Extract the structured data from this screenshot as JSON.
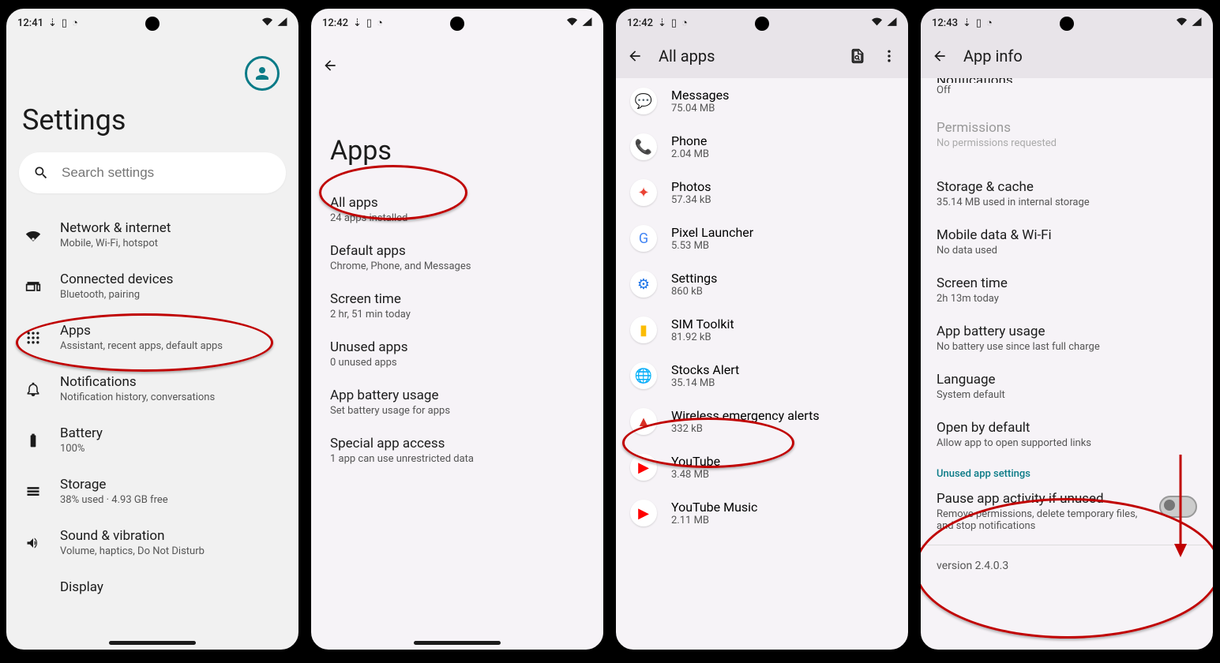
{
  "phones": [
    {
      "time": "12:41",
      "title": "Settings",
      "search_placeholder": "Search settings",
      "items": [
        {
          "title": "Network & internet",
          "sub": "Mobile, Wi-Fi, hotspot"
        },
        {
          "title": "Connected devices",
          "sub": "Bluetooth, pairing"
        },
        {
          "title": "Apps",
          "sub": "Assistant, recent apps, default apps"
        },
        {
          "title": "Notifications",
          "sub": "Notification history, conversations"
        },
        {
          "title": "Battery",
          "sub": "100%"
        },
        {
          "title": "Storage",
          "sub": "38% used · 4.93 GB free"
        },
        {
          "title": "Sound & vibration",
          "sub": "Volume, haptics, Do Not Disturb"
        },
        {
          "title": "Display",
          "sub": ""
        }
      ]
    },
    {
      "time": "12:42",
      "title": "Apps",
      "items": [
        {
          "title": "All apps",
          "sub": "24 apps installed"
        },
        {
          "title": "Default apps",
          "sub": "Chrome, Phone, and Messages"
        },
        {
          "title": "Screen time",
          "sub": "2 hr, 51 min today"
        },
        {
          "title": "Unused apps",
          "sub": "0 unused apps"
        },
        {
          "title": "App battery usage",
          "sub": "Set battery usage for apps"
        },
        {
          "title": "Special app access",
          "sub": "1 app can use unrestricted data"
        }
      ]
    },
    {
      "time": "12:42",
      "title": "All apps",
      "apps": [
        {
          "name": "Messages",
          "size": "75.04 MB",
          "color": "#1a73e8",
          "glyph": "💬"
        },
        {
          "name": "Phone",
          "size": "2.04 MB",
          "color": "#1a73e8",
          "glyph": "📞"
        },
        {
          "name": "Photos",
          "size": "57.34 kB",
          "color": "#ea4335",
          "glyph": "✦"
        },
        {
          "name": "Pixel Launcher",
          "size": "5.53 MB",
          "color": "#4285f4",
          "glyph": "G"
        },
        {
          "name": "Settings",
          "size": "860 kB",
          "color": "#1a73e8",
          "glyph": "⚙"
        },
        {
          "name": "SIM Toolkit",
          "size": "81.92 kB",
          "color": "#fbbc04",
          "glyph": "▮"
        },
        {
          "name": "Stocks Alert",
          "size": "35.14 MB",
          "color": "#6b8e23",
          "glyph": "🌐"
        },
        {
          "name": "Wireless emergency alerts",
          "size": "332 kB",
          "color": "#d93025",
          "glyph": "▲"
        },
        {
          "name": "YouTube",
          "size": "3.48 MB",
          "color": "#ff0000",
          "glyph": "▶"
        },
        {
          "name": "YouTube Music",
          "size": "2.11 MB",
          "color": "#ff0000",
          "glyph": "▶"
        }
      ]
    },
    {
      "time": "12:43",
      "title": "App info",
      "partial": {
        "title": "Notifications",
        "sub": "Off"
      },
      "items": [
        {
          "title": "Permissions",
          "sub": "No permissions requested",
          "greyed": true
        },
        {
          "title": "Storage & cache",
          "sub": "35.14 MB used in internal storage"
        },
        {
          "title": "Mobile data & Wi-Fi",
          "sub": "No data used"
        },
        {
          "title": "Screen time",
          "sub": "2h 13m today"
        },
        {
          "title": "App battery usage",
          "sub": "No battery use since last full charge"
        },
        {
          "title": "Language",
          "sub": "System default"
        },
        {
          "title": "Open by default",
          "sub": "Allow app to open supported links"
        }
      ],
      "section": "Unused app settings",
      "toggle": {
        "title": "Pause app activity if unused",
        "sub": "Remove permissions, delete temporary files, and stop notifications"
      },
      "version": "version 2.4.0.3"
    }
  ]
}
